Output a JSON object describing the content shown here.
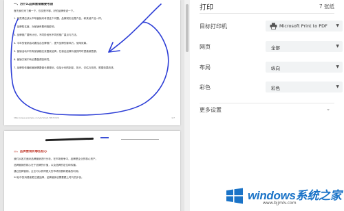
{
  "preview": {
    "page1": {
      "title": "一、为什么品牌营销需要考虑",
      "intro": "首先我们来了解一下，仅仅是不够，好的品牌来说一下。",
      "items": [
        "1. 我觉得应该从市场营销来考虑这个问题。品牌其实也是产品，和其他产品一样。",
        "2. 品牌知名度，对营销有着积极影响。",
        "3. 品牌推广要有计划，不同阶段有不同的推广重点与方法。",
        "4. 今年的营销活动要结合品牌推广，提升品牌的影响力，使用效果。",
        "5. 营销活动中所有营销都应该围绕品牌，在保证品牌价值的同时提高销售额。",
        "6. 营销方案中有必要做调查研究。",
        "7. 品牌的传播和营销需要做长期规划，包括计划的制定、执行、评估与改进，根据效果改进。"
      ],
      "footer_url": "http://www.example.com/article/17057.html",
      "page_number": "1/7"
    },
    "page2": {
      "title": "二、品牌营销有哪些核心",
      "paragraphs": [
        "我们从各方面对品牌营销进行分析，在市场竞争中，品牌是企业的核心资产。",
        "品牌营销的核心在于品牌的价值，以及品牌的定位和传播。",
        "通过品牌营销，企业可以获得更大的市场份额和更高的利润。",
        "90后中的消费者更注重品牌，品牌营销也需要跟上时代的步伐。"
      ]
    }
  },
  "settings": {
    "title": "打印",
    "sheet_count": "7 张纸",
    "rows": {
      "destination": {
        "label": "目标打印机",
        "value": "Microsoft Print to PDF",
        "icon": "printer-icon"
      },
      "pages": {
        "label": "网页",
        "value": "全部"
      },
      "layout": {
        "label": "布局",
        "value": "纵向"
      },
      "color": {
        "label": "彩色",
        "value": "彩色"
      }
    },
    "more_settings": "更多设置"
  },
  "watermark": {
    "title": "windows系统之家",
    "subtitle": "www.bjjmlv.com"
  },
  "colors": {
    "annotation": "#2d3ed6",
    "select_bg": "#f1f3f4",
    "watermark_blue": "#1a73c7"
  }
}
